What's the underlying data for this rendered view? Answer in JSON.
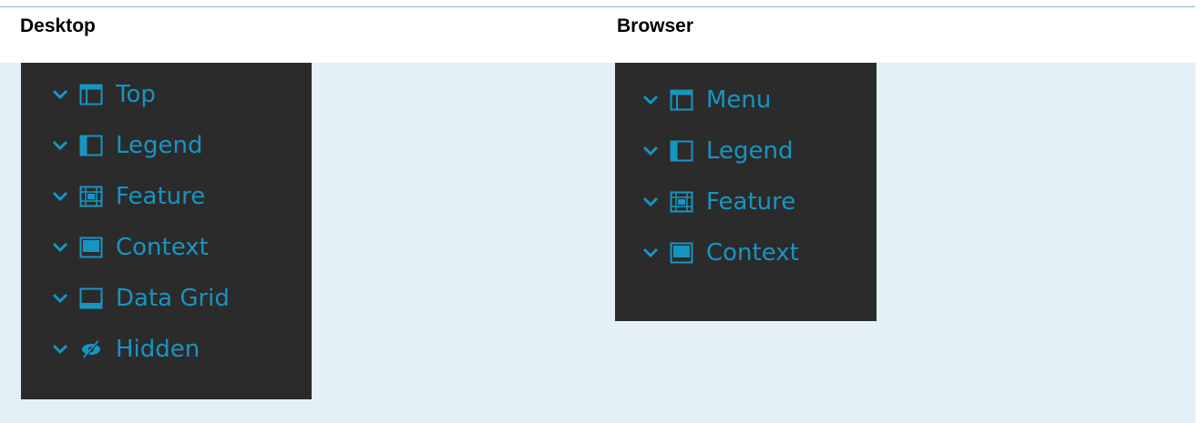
{
  "columns": {
    "desktop": {
      "header": "Desktop"
    },
    "browser": {
      "header": "Browser"
    }
  },
  "desktop_items": [
    {
      "label": "Top",
      "icon": "panel-top-icon"
    },
    {
      "label": "Legend",
      "icon": "panel-left-icon"
    },
    {
      "label": "Feature",
      "icon": "panel-feature-icon"
    },
    {
      "label": "Context",
      "icon": "panel-context-icon"
    },
    {
      "label": "Data Grid",
      "icon": "panel-bottom-icon"
    },
    {
      "label": "Hidden",
      "icon": "eye-slash-icon"
    }
  ],
  "browser_items": [
    {
      "label": "Menu",
      "icon": "panel-top-icon"
    },
    {
      "label": "Legend",
      "icon": "panel-left-icon"
    },
    {
      "label": "Feature",
      "icon": "panel-feature-icon"
    },
    {
      "label": "Context",
      "icon": "panel-context-icon"
    }
  ],
  "colors": {
    "accent": "#1795c1",
    "panel_bg": "#2b2b2b",
    "row_bg": "#e3f1f6",
    "border": "#7fc4d1"
  }
}
